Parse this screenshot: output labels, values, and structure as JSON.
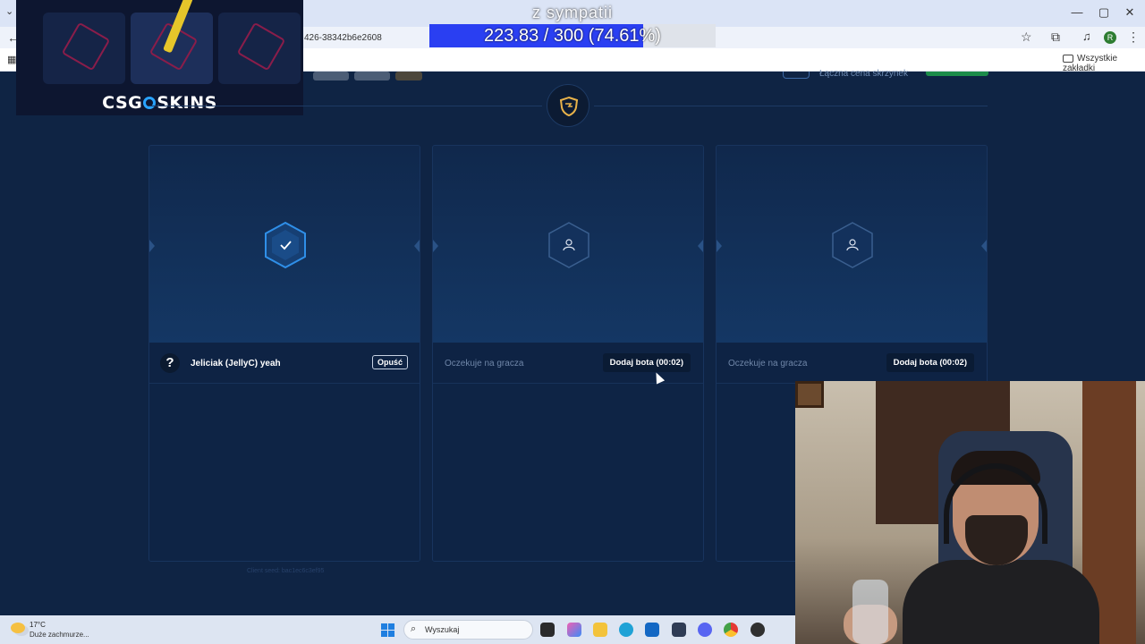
{
  "browser": {
    "url_fragment": "426-38342b6e2608",
    "bookmarks_folder": "Wszystkie zakładki",
    "profile_initial": "R",
    "window_controls": [
      "—",
      "▢",
      "✕"
    ]
  },
  "stream_goal": {
    "title": "z sympatii",
    "progress_text": "223.83 / 300 (74.61%)",
    "progress_fraction": 0.7461,
    "fill_color": "#2a3ff2"
  },
  "overlay": {
    "brand_left": "CSG",
    "brand_right": "SKINS"
  },
  "top_strip": {
    "label": "Łączna cena skrzynek"
  },
  "slots": [
    {
      "state": "joined",
      "avatar_glyph": "?",
      "player_name": "Jeliciak (JellyC) yeah",
      "action_label": "Opuść"
    },
    {
      "state": "waiting",
      "status_text": "Oczekuje na gracza",
      "action_label": "Dodaj bota (00:02)"
    },
    {
      "state": "waiting",
      "status_text": "Oczekuje na gracza",
      "action_label": "Dodaj bota (00:02)"
    }
  ],
  "footer": {
    "client_seed": "Client seed: bac1ec6c3ef95"
  },
  "taskbar": {
    "temperature": "17°C",
    "weather_desc": "Duże zachmurze...",
    "search_placeholder": "Wyszukaj",
    "apps": [
      "file-explorer-icon",
      "copilot-icon",
      "folder-icon",
      "edge-icon",
      "outlook-icon",
      "store-icon",
      "discord-icon",
      "chrome-icon",
      "obs-icon"
    ]
  },
  "colors": {
    "page_bg": "#0f2444",
    "accent_blue": "#2f8fe8",
    "bot_button_bg": "#0a1b34"
  }
}
